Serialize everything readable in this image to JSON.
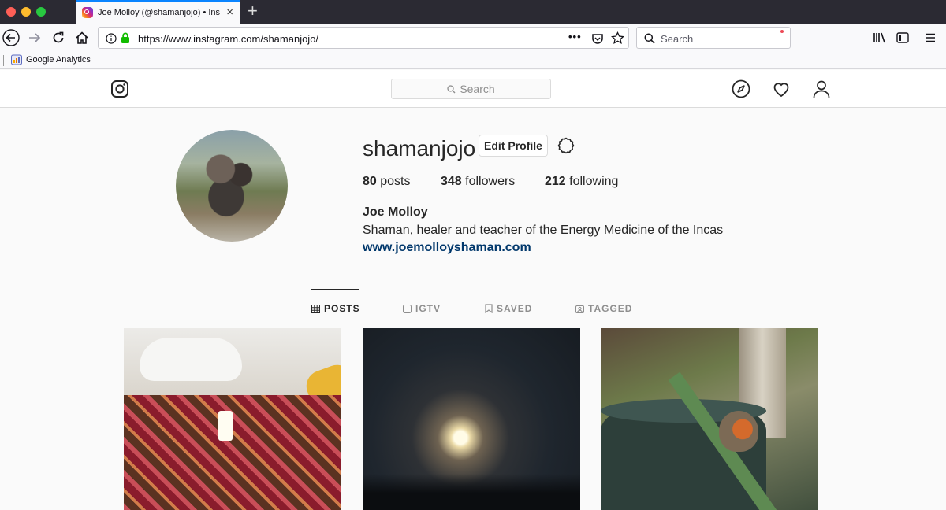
{
  "browser": {
    "tab_title": "Joe Molloy (@shamanjojo) • Ins",
    "url_host": "https://www.instagram.com",
    "url_path": "/shamanjojo/",
    "search_placeholder": "Search",
    "url_more": "•••",
    "bookmarks": [
      {
        "label": "Google Analytics",
        "icon": "google-analytics-icon"
      }
    ]
  },
  "ig_header": {
    "search_placeholder": "Search",
    "icons": [
      "instagram-logo-icon",
      "explore-compass-icon",
      "activity-heart-icon",
      "profile-person-icon"
    ],
    "notification_dot_color": "#ed4956"
  },
  "profile": {
    "username": "shamanjojo",
    "edit_profile_label": "Edit Profile",
    "stats": {
      "posts_count": "80",
      "posts_label": "posts",
      "followers_count": "348",
      "followers_label": "followers",
      "following_count": "212",
      "following_label": "following"
    },
    "full_name": "Joe Molloy",
    "bio": "Shaman, healer and teacher of the Energy Medicine of the Incas",
    "website": "www.joemolloyshaman.com"
  },
  "tabs": [
    {
      "label": "POSTS",
      "icon": "grid-icon",
      "active": true
    },
    {
      "label": "IGTV",
      "icon": "igtv-icon",
      "active": false
    },
    {
      "label": "SAVED",
      "icon": "bookmark-icon",
      "active": false
    },
    {
      "label": "TAGGED",
      "icon": "tagged-icon",
      "active": false
    }
  ],
  "colors": {
    "link": "#00376b",
    "text": "#262626",
    "muted": "#8e8e8e",
    "tab_accent": "#0a84ff"
  }
}
